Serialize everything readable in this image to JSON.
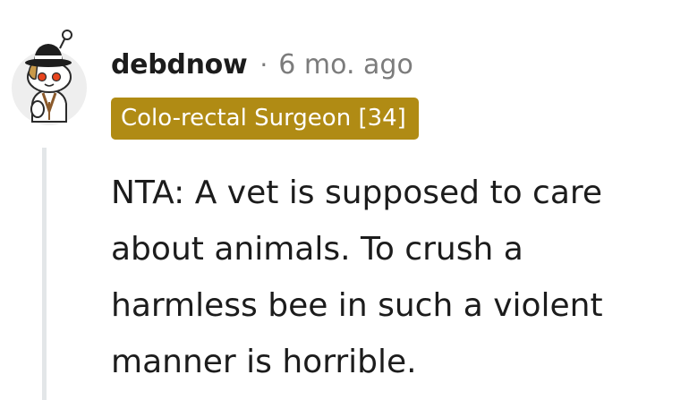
{
  "comment": {
    "username": "debdnow",
    "separator": "·",
    "timestamp": "6 mo. ago",
    "flair": "Colo-rectal Surgeon [34]",
    "body": "NTA: A vet is supposed to care about animals. To crush a harmless bee in such a violent manner is horrible."
  },
  "colors": {
    "flair_background": "#b08b14",
    "flair_text": "#ffffff",
    "username": "#1c1c1c",
    "meta_text": "#7c7c7c",
    "thread_line": "#e3e6e8"
  },
  "icons": {
    "avatar": "snoo-avatar-with-fedora"
  }
}
